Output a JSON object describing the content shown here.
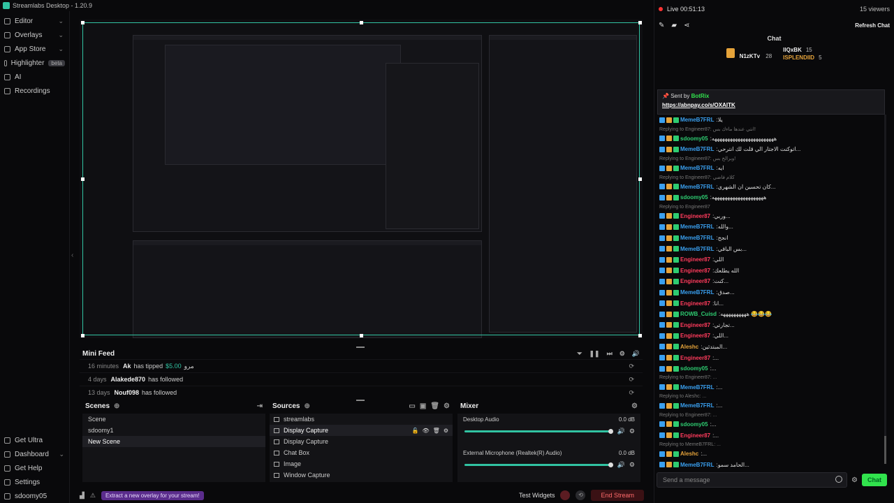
{
  "app": {
    "title": "Streamlabs Desktop - 1.20.9",
    "win_min": "—",
    "win_max": "□",
    "win_close": "✕"
  },
  "sidebar": {
    "items": [
      {
        "label": "Editor",
        "icon": "editor-icon",
        "chev": "⌄"
      },
      {
        "label": "Overlays",
        "icon": "overlays-icon",
        "chev": "⌄"
      },
      {
        "label": "App Store",
        "icon": "store-icon",
        "chev": "⌄"
      },
      {
        "label": "Highlighter",
        "icon": "highlighter-icon",
        "badge": "beta"
      },
      {
        "label": "AI",
        "icon": "ai-icon"
      },
      {
        "label": "Recordings",
        "icon": "recordings-icon"
      }
    ],
    "bottom": [
      {
        "label": "Get Ultra",
        "icon": "ultra-icon"
      },
      {
        "label": "Dashboard",
        "icon": "dashboard-icon",
        "chev": "⌄"
      },
      {
        "label": "Get Help",
        "icon": "help-icon"
      },
      {
        "label": "Settings",
        "icon": "settings-icon"
      },
      {
        "label": "sdoomy05",
        "icon": "avatar-icon"
      }
    ]
  },
  "minifeed": {
    "title": "Mini Feed",
    "rows": [
      {
        "time": "16 minutes",
        "user": "Ak",
        "action": "has tipped",
        "amount": "$5.00",
        "extra": "مرو"
      },
      {
        "time": "4 days",
        "user": "Alakede870",
        "action": "has followed"
      },
      {
        "time": "13 days",
        "user": "Nouf098",
        "action": "has followed"
      }
    ]
  },
  "scenes": {
    "title": "Scenes",
    "items": [
      "Scene",
      "sdoomy1",
      "New Scene"
    ],
    "active": 2
  },
  "sources": {
    "title": "Sources",
    "items": [
      "streamlabs",
      "Display Capture",
      "Display Capture",
      "Chat Box",
      "Image",
      "Window Capture"
    ],
    "active": 1
  },
  "mixer": {
    "title": "Mixer",
    "channels": [
      {
        "name": "Desktop Audio",
        "db": "0.0 dB",
        "level": 1.0
      },
      {
        "name": "External Microphone (Realtek(R) Audio)",
        "db": "0.0 dB",
        "level": 1.0
      }
    ]
  },
  "footer": {
    "overlay_pill": "Extract a new overlay for your stream!",
    "test_widgets": "Test Widgets",
    "end_stream": "End Stream"
  },
  "chat": {
    "live": "Live 00:51:13",
    "viewers": "15 viewers",
    "refresh": "Refresh Chat",
    "title": "Chat",
    "leader": [
      {
        "name": "N1zKTv",
        "pts": "28"
      },
      {
        "name": "lIQxBK",
        "pts": "15"
      },
      {
        "name": "ISPLENDIID",
        "pts": "5"
      }
    ],
    "pinned_by": "Sent by",
    "pinned_user": "BotRix",
    "pinned_link": "https://abnpay.co/s/OXAITK",
    "input_placeholder": "Send a message",
    "send": "Chat",
    "messages": [
      {
        "u": "MemeB7FRL",
        "c": "#3aa0f0",
        "t": "يلا"
      },
      {
        "r": "Replying to Engineer87: انتي عندها ماءك بس!"
      },
      {
        "u": "sdoomy05",
        "c": "#2ecc71",
        "t": "ههههههههههههههههههههههههه"
      },
      {
        "u": "MemeB7FRL",
        "c": "#3aa0f0",
        "t": "اتوكنت الاجتار الي قلت لك انترحي..."
      },
      {
        "r": "Replying to Engineer87: وبرالخ بس!"
      },
      {
        "u": "MemeB7FRL",
        "c": "#3aa0f0",
        "t": "ايه"
      },
      {
        "r": "Replying to Engineer87: كلام فاضي"
      },
      {
        "u": "MemeB7FRL",
        "c": "#3aa0f0",
        "t": "كان تحسين ان الشهري..."
      },
      {
        "u": "sdoomy05",
        "c": "#2ecc71",
        "t": "ههههههههههههههههههههه"
      },
      {
        "r": "Replying to Engineer87"
      },
      {
        "u": "Engineer87",
        "c": "#ff3b5c",
        "t": "وربي..."
      },
      {
        "u": "MemeB7FRL",
        "c": "#3aa0f0",
        "t": "والله..."
      },
      {
        "u": "MemeB7FRL",
        "c": "#3aa0f0",
        "t": "انجح"
      },
      {
        "u": "MemeB7FRL",
        "c": "#3aa0f0",
        "t": "بس الباقي..."
      },
      {
        "u": "Engineer87",
        "c": "#ff3b5c",
        "t": "اللي"
      },
      {
        "u": "Engineer87",
        "c": "#ff3b5c",
        "t": "الله يطلعك"
      },
      {
        "u": "Engineer87",
        "c": "#ff3b5c",
        "t": "كنت..."
      },
      {
        "u": "MemeB7FRL",
        "c": "#3aa0f0",
        "t": "صدق..."
      },
      {
        "u": "Engineer87",
        "c": "#ff3b5c",
        "t": "انا..."
      },
      {
        "u": "ROWB_Cuisd",
        "c": "#2ecc71",
        "t": "ههههههههههه 😂😂😂"
      },
      {
        "u": "Engineer87",
        "c": "#ff3b5c",
        "t": "تجارتي..."
      },
      {
        "u": "Engineer87",
        "c": "#ff3b5c",
        "t": "اللي..."
      },
      {
        "u": "Aleshc",
        "c": "#e5a33a",
        "t": "المبتدئين..."
      },
      {
        "u": "Engineer87",
        "c": "#ff3b5c",
        "t": "..."
      },
      {
        "u": "sdoomy05",
        "c": "#2ecc71",
        "t": "..."
      },
      {
        "r": "Replying to Engineer87: ..."
      },
      {
        "u": "MemeB7FRL",
        "c": "#3aa0f0",
        "t": "..."
      },
      {
        "r": "Replying to Aleshc: ..."
      },
      {
        "u": "MemeB7FRL",
        "c": "#3aa0f0",
        "t": "..."
      },
      {
        "r": "Replying to Engineer87: ..."
      },
      {
        "u": "sdoomy05",
        "c": "#2ecc71",
        "t": "..."
      },
      {
        "u": "Engineer87",
        "c": "#ff3b5c",
        "t": "..."
      },
      {
        "r": "Replying to MemeB7FRL: ..."
      },
      {
        "u": "Aleshc",
        "c": "#e5a33a",
        "t": "..."
      },
      {
        "u": "MemeB7FRL",
        "c": "#3aa0f0",
        "t": "الحامد سمو..."
      },
      {
        "u": "Engineer87",
        "c": "#ff3b5c",
        "t": "..."
      },
      {
        "u": "MemeB7FRL",
        "c": "#3aa0f0",
        "t": "..."
      }
    ]
  }
}
